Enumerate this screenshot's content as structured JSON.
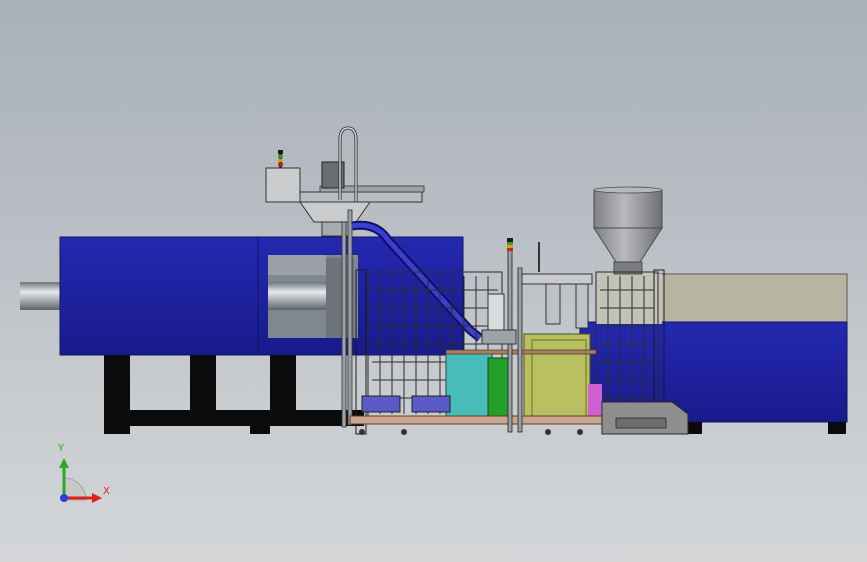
{
  "triad": {
    "x_label": "X",
    "y_label": "Y",
    "colors": {
      "x": "#d9221d",
      "y": "#2aa62a",
      "z": "#2c3ed6"
    }
  },
  "colors": {
    "machine_blue": "#1f22a6",
    "frame_black": "#0b0b0b",
    "hopper_gray": "#9a9a9a",
    "barrel_beige": "#b5b5a2",
    "cabinet_yellow": "#b9c060",
    "cabinet_teal": "#48bcb8",
    "cabinet_green": "#22a02a",
    "drawer_purple": "#5a5ac8",
    "accent_magenta": "#d060d0"
  }
}
